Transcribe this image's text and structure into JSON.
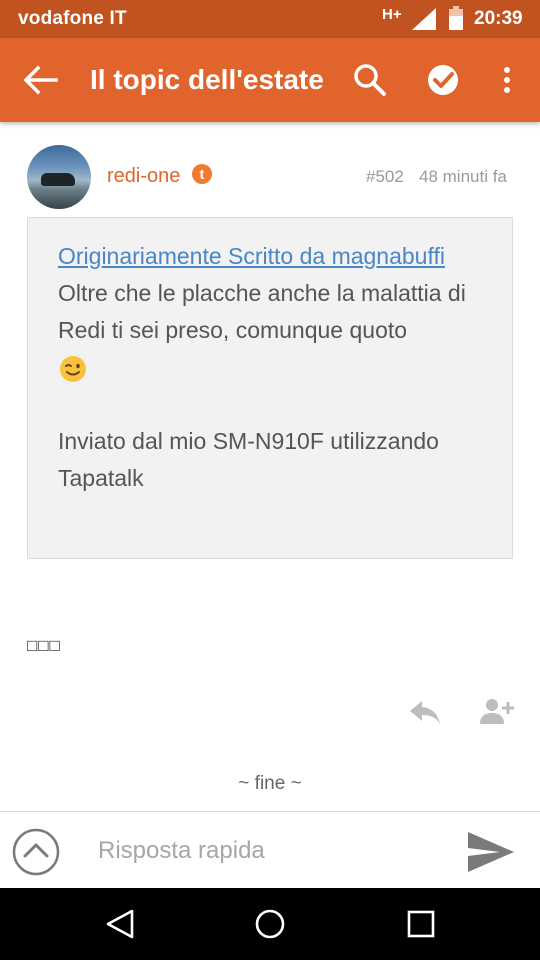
{
  "status_bar": {
    "carrier": "vodafone IT",
    "network": "H+",
    "time": "20:39"
  },
  "app_bar": {
    "title": "Il topic dell'estate",
    "icons": [
      "back-arrow-icon",
      "search-icon",
      "check-circle-icon",
      "more-vert-icon"
    ]
  },
  "post": {
    "username": "redi-one",
    "badge": "t",
    "post_number": "#502",
    "time_ago": "48 minuti fa",
    "quote": {
      "link_text": "Originariamente Scritto da magnabuffi",
      "text": "Oltre che le placche anche la malattia di Redi ti sei preso, comunque quoto",
      "emoji": "winking-face-emoji",
      "signature": "Inviato dal mio SM-N910F utilizzando Tapatalk"
    },
    "body_glyphs": "□□□",
    "actions": [
      "reply-icon",
      "add-person-icon"
    ]
  },
  "end_marker": "~ fine ~",
  "reply_bar": {
    "placeholder": "Risposta rapida"
  },
  "colors": {
    "status_bar": "#c0531f",
    "app_bar": "#e2642d",
    "username": "#e2642d",
    "link": "#4a86c5",
    "quote_bg": "#f2f2f2"
  }
}
